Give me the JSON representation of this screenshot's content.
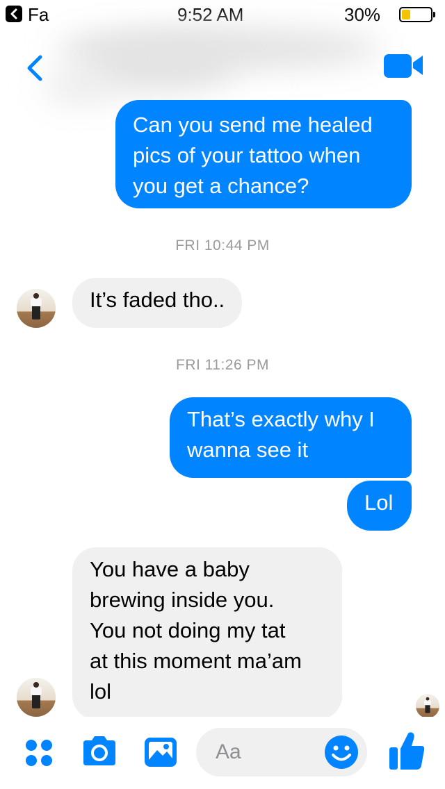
{
  "status_bar": {
    "back_app_label": "Fa",
    "time": "9:52 AM",
    "battery_percent": "30%",
    "battery_level": 0.3,
    "battery_color": "#f5c400"
  },
  "header": {
    "back_icon": "chevron-left-icon",
    "contact_name": "",
    "video_icon": "video-camera-icon",
    "accent_color": "#0084ff"
  },
  "messages": [
    {
      "type": "outgoing",
      "text": "Can you send me healed\npics of your tattoo when\nyou get a chance?"
    },
    {
      "type": "timestamp",
      "text": "FRI 10:44 PM"
    },
    {
      "type": "incoming",
      "text": "It’s faded tho.."
    },
    {
      "type": "timestamp",
      "text": "FRI 11:26 PM"
    },
    {
      "type": "outgoing",
      "text": "That’s exactly why I\nwanna see it"
    },
    {
      "type": "outgoing",
      "text": "Lol"
    },
    {
      "type": "incoming",
      "text": "You have a baby\nbrewing inside you.\nYou not doing my tat\nat this moment ma’am\nlol"
    }
  ],
  "composer": {
    "placeholder": "Aa",
    "icons": [
      "more-apps-icon",
      "camera-icon",
      "photo-gallery-icon",
      "emoji-icon",
      "thumbs-up-icon"
    ]
  },
  "colors": {
    "outgoing_bubble": "#0084ff",
    "incoming_bubble": "#f1f0f0",
    "timestamp_text": "#9a9a9a"
  }
}
